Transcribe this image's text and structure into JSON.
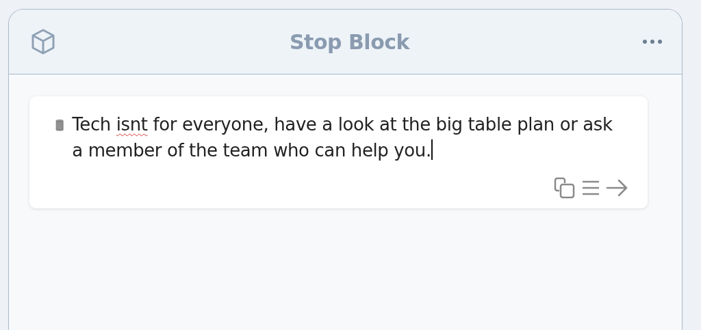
{
  "panel": {
    "title": "Stop Block"
  },
  "message": {
    "segments": [
      {
        "text": "Tech ",
        "misspelled": false
      },
      {
        "text": "isnt",
        "misspelled": true
      },
      {
        "text": " for everyone, have a look at the big table plan or ask a member of the team who can help you.",
        "misspelled": false
      }
    ],
    "cursor": true
  }
}
